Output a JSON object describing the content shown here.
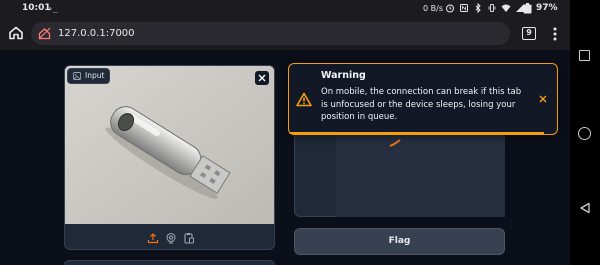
{
  "status_bar": {
    "time": "10:01",
    "terminal_glyph": "›_",
    "data_rate": "0 B/s",
    "battery": "97%"
  },
  "browser": {
    "url": "127.0.0.1:7000",
    "tab_count": "9"
  },
  "input": {
    "label": "Input"
  },
  "flag_button": {
    "label": "Flag"
  },
  "toast": {
    "title": "Warning",
    "message": "On mobile, the connection can break if this tab is unfocused or the device sleeps, losing your position in queue.",
    "progress": 0.95
  },
  "colors": {
    "accent": "#f59e0b",
    "background": "#0b0f19",
    "panel": "#1f2937"
  }
}
